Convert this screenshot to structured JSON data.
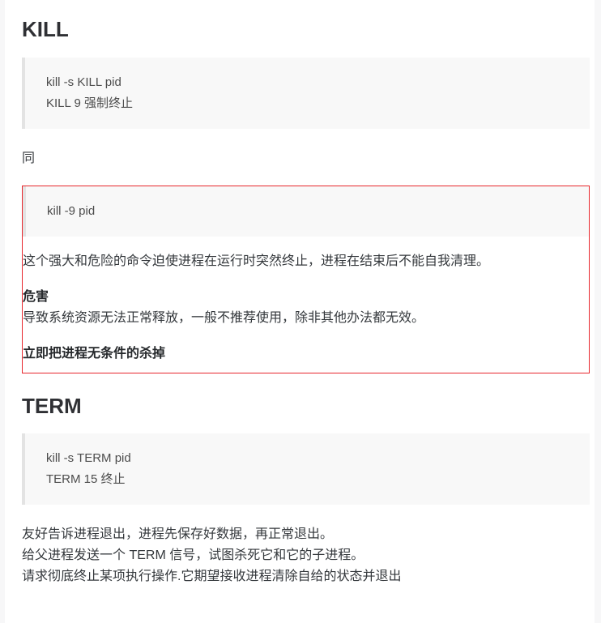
{
  "document": {
    "sections": [
      {
        "heading": "KILL",
        "code_lines": [
          "kill -s KILL pid",
          "KILL 9 强制终止"
        ]
      },
      {
        "heading": "TERM",
        "code_lines": [
          "kill -s TERM pid",
          "TERM 15 终止"
        ]
      }
    ],
    "same_note": "同",
    "danger": {
      "code_line": "kill -9 pid",
      "description": "这个强大和危险的命令迫使进程在运行时突然终止，进程在结束后不能自我清理。",
      "harm_heading": "危害",
      "harm_text": "导致系统资源无法正常释放，一般不推荐使用，除非其他办法都无效。",
      "conclusion": "立即把进程无条件的杀掉",
      "border_color": "#e8272c"
    },
    "term_notes": [
      "友好告诉进程退出，进程先保存好数据，再正常退出。",
      "给父进程发送一个 TERM 信号，试图杀死它和它的子进程。",
      "请求彻底终止某项执行操作.它期望接收进程清除自给的状态并退出"
    ]
  }
}
